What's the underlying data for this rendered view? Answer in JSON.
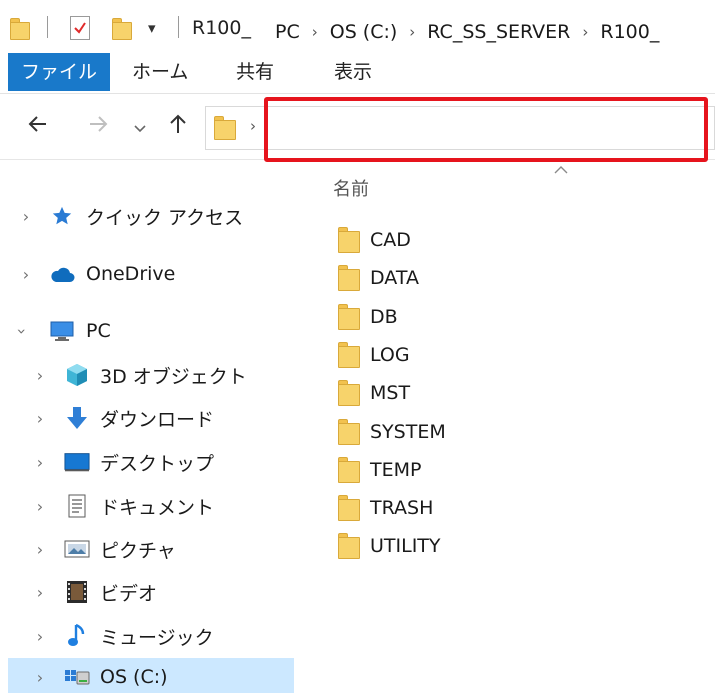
{
  "window": {
    "title": "R100_"
  },
  "ribbon": {
    "tabs": [
      {
        "label": "ファイル"
      },
      {
        "label": "ホーム"
      },
      {
        "label": "共有"
      },
      {
        "label": "表示"
      }
    ]
  },
  "address": {
    "crumbs": [
      "PC",
      "OS (C:)",
      "RC_SS_SERVER",
      "R100_"
    ]
  },
  "list": {
    "column_name": "名前",
    "folders": [
      "CAD",
      "DATA",
      "DB",
      "LOG",
      "MST",
      "SYSTEM",
      "TEMP",
      "TRASH",
      "UTILITY"
    ]
  },
  "nav": {
    "quick_access": "クイック アクセス",
    "onedrive": "OneDrive",
    "pc": "PC",
    "objects3d": "3D オブジェクト",
    "downloads": "ダウンロード",
    "desktop": "デスクトップ",
    "documents": "ドキュメント",
    "pictures": "ピクチャ",
    "videos": "ビデオ",
    "music": "ミュージック",
    "os_drive": "OS (C:)"
  },
  "colors": {
    "file_tab": "#1979ca",
    "highlight_box": "#e6141d",
    "selected_row": "#cce8ff",
    "folder": "#f7d36b"
  }
}
